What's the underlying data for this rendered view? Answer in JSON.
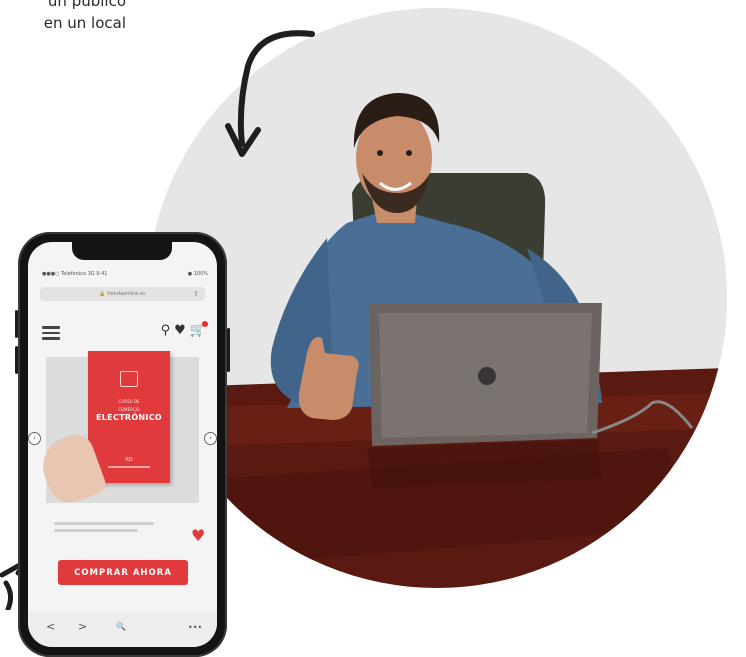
{
  "caption": {
    "line1": "un público",
    "line2": "en un local"
  },
  "phone": {
    "status_left": "●●●○ Telefonica  3G   9:41",
    "status_right": "● 100%",
    "url": "🔒 tiendaonline.es",
    "header_icons": [
      "search-icon",
      "heart-icon",
      "cart-icon"
    ],
    "book": {
      "top_small": "CURSO DE",
      "title": "ELECTRÓNICO",
      "subtitle_small": "COMERCIO",
      "bottom_small": "RD"
    },
    "buy_button": "COMPRAR AHORA",
    "nav": {
      "back": "<",
      "forward": ">",
      "search": "🔍",
      "more": "•••"
    }
  },
  "colors": {
    "accent": "#e03a3c",
    "photo_bg": "#e7e7e7"
  }
}
